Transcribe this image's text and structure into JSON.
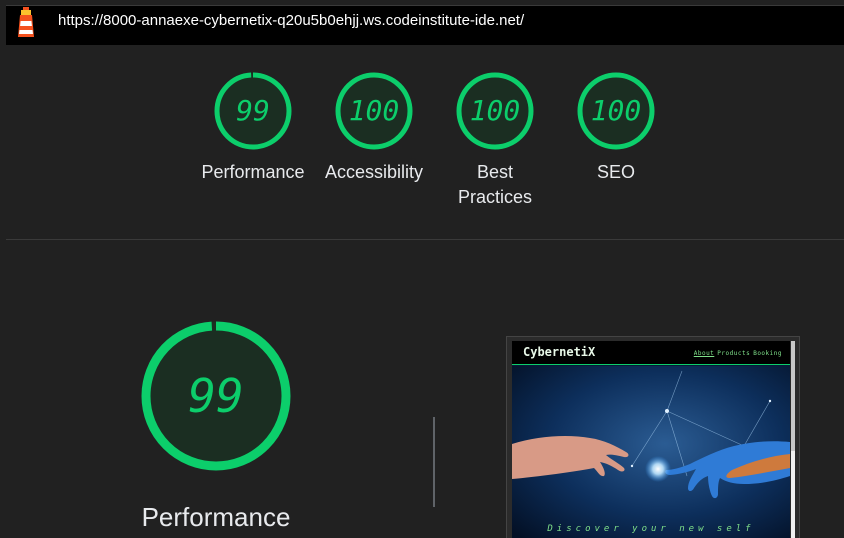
{
  "address_bar": {
    "url": "https://8000-annaexe-cybernetix-q20u5b0ehjj.ws.codeinstitute-ide.net/",
    "icon": "lighthouse-icon"
  },
  "summary_gauges": [
    {
      "label": "Performance",
      "score": "99",
      "fraction": 0.99
    },
    {
      "label": "Accessibility",
      "score": "100",
      "fraction": 1.0
    },
    {
      "label": "Best Practices",
      "score": "100",
      "fraction": 1.0
    },
    {
      "label": "SEO",
      "score": "100",
      "fraction": 1.0
    }
  ],
  "category_detail": {
    "label": "Performance",
    "score": "99",
    "fraction": 0.99
  },
  "screenshot_preview": {
    "brand": "CybernetiX",
    "nav_links": [
      "About",
      "Products",
      "Booking"
    ],
    "active_link": "About",
    "tagline": "Discover your new self"
  },
  "colors": {
    "pass_green": "#0cce6b",
    "gauge_fill": "#1b2e22",
    "background": "#212121"
  }
}
